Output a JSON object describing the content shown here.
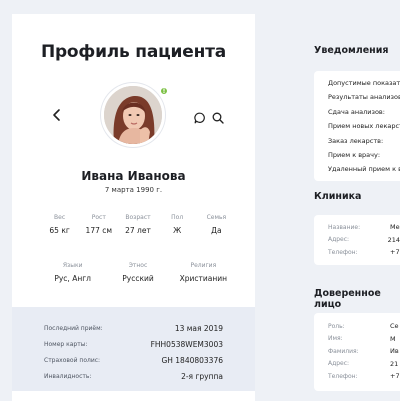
{
  "profile": {
    "title": "Профиль пациента",
    "name": "Ивана Иванова",
    "dob": "7 марта 1990 г.",
    "stats": [
      {
        "label": "Вес",
        "value": "65 кг"
      },
      {
        "label": "Рост",
        "value": "177 см"
      },
      {
        "label": "Возраст",
        "value": "27 лет"
      },
      {
        "label": "Пол",
        "value": "Ж"
      },
      {
        "label": "Семья",
        "value": "Да"
      }
    ],
    "stats2": [
      {
        "label": "Языки",
        "value": "Рус, Англ"
      },
      {
        "label": "Этнос",
        "value": "Русский"
      },
      {
        "label": "Религия",
        "value": "Христианин"
      }
    ],
    "info": [
      {
        "label": "Последний приём:",
        "value": "13 мая 2019"
      },
      {
        "label": "Номер карты:",
        "value": "FHH0538WEM3003"
      },
      {
        "label": "Страховой полис:",
        "value": "GH 1840803376"
      },
      {
        "label": "Инвалидность:",
        "value": "2-я группа"
      }
    ],
    "online_badge": "!"
  },
  "notifications": {
    "title": "Уведомления",
    "items": [
      "Допустимые показате",
      "Результаты анализов:",
      "Сдача анализов:",
      "Прием новых лекарст",
      "Заказ лекарств:",
      "Прием к врачу:",
      "Удаленный прием к в"
    ]
  },
  "clinic": {
    "title": "Клиника",
    "rows": [
      {
        "label": "Название:",
        "value": "Ме"
      },
      {
        "label": "Адрес:",
        "value": "214"
      },
      {
        "label": "Телефон:",
        "value": "+7 "
      }
    ]
  },
  "trusted": {
    "title": "Доверенное лицо",
    "rows": [
      {
        "label": "Роль:",
        "value": "Се"
      },
      {
        "label": "Имя:",
        "value": "М"
      },
      {
        "label": "Фамилия:",
        "value": "Ив"
      },
      {
        "label": "Адрес:",
        "value": "21"
      },
      {
        "label": "Телефон:",
        "value": "+7 "
      }
    ]
  }
}
